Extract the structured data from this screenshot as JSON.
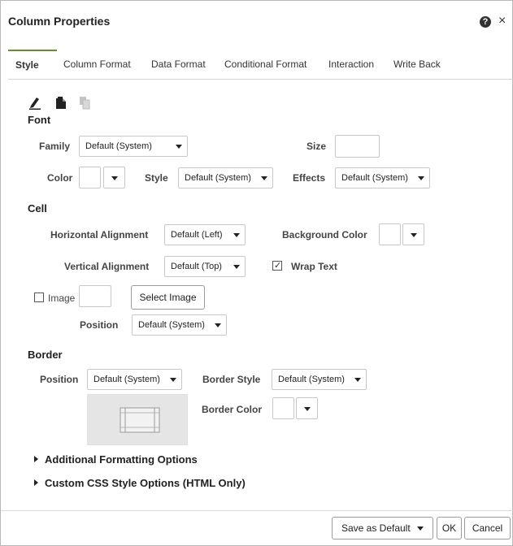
{
  "dialog": {
    "title": "Column Properties",
    "help_icon": "help-icon",
    "close_glyph": "×"
  },
  "tabs": [
    {
      "label": "Style",
      "active": true
    },
    {
      "label": "Column Format"
    },
    {
      "label": "Data Format"
    },
    {
      "label": "Conditional Format"
    },
    {
      "label": "Interaction"
    },
    {
      "label": "Write Back"
    }
  ],
  "toolbar": {
    "icons": [
      "edit-icon",
      "paste-icon",
      "copy-icon-disabled"
    ]
  },
  "font": {
    "section_title": "Font",
    "family_label": "Family",
    "family_value": "Default (System)",
    "size_label": "Size",
    "size_value": "",
    "color_label": "Color",
    "style_label": "Style",
    "style_value": "Default (System)",
    "effects_label": "Effects",
    "effects_value": "Default (System)"
  },
  "cell": {
    "section_title": "Cell",
    "h_align_label": "Horizontal Alignment",
    "h_align_value": "Default (Left)",
    "bg_color_label": "Background Color",
    "v_align_label": "Vertical Alignment",
    "v_align_value": "Default (Top)",
    "wrap_text_label": "Wrap Text",
    "wrap_text_checked": true,
    "image_label": "Image",
    "image_checked": false,
    "select_image_label": "Select Image",
    "position_label": "Position",
    "position_value": "Default (System)"
  },
  "border": {
    "section_title": "Border",
    "position_label": "Position",
    "position_value": "Default (System)",
    "style_label": "Border Style",
    "style_value": "Default (System)",
    "color_label": "Border Color"
  },
  "expanders": {
    "additional": "Additional Formatting Options",
    "custom_css": "Custom CSS Style Options (HTML Only)"
  },
  "footer": {
    "save_default": "Save as Default",
    "ok": "OK",
    "cancel": "Cancel"
  },
  "colors": {
    "active_tab_accent": "#6a8a30",
    "text": "#333333",
    "border": "#c8c8c8"
  }
}
